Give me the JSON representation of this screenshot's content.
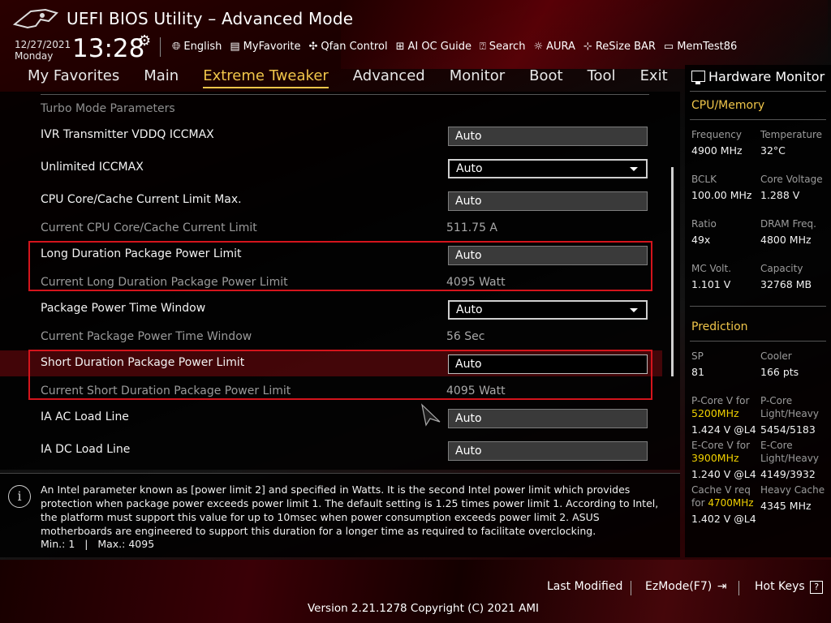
{
  "app": {
    "title": "UEFI BIOS Utility – Advanced Mode"
  },
  "datetime": {
    "date": "12/27/2021",
    "day": "Monday",
    "time": "13:28"
  },
  "toolbar": [
    {
      "label": "English",
      "icon": "globe-icon"
    },
    {
      "label": "MyFavorite",
      "icon": "favorite-icon"
    },
    {
      "label": "Qfan Control",
      "icon": "fan-icon"
    },
    {
      "label": "AI OC Guide",
      "icon": "ai-guide-icon"
    },
    {
      "label": "Search",
      "icon": "search-icon"
    },
    {
      "label": "AURA",
      "icon": "aura-icon"
    },
    {
      "label": "ReSize BAR",
      "icon": "resize-bar-icon"
    },
    {
      "label": "MemTest86",
      "icon": "memtest-icon"
    }
  ],
  "menu": [
    {
      "label": "My Favorites",
      "active": false
    },
    {
      "label": "Main",
      "active": false
    },
    {
      "label": "Extreme Tweaker",
      "active": true
    },
    {
      "label": "Advanced",
      "active": false
    },
    {
      "label": "Monitor",
      "active": false
    },
    {
      "label": "Boot",
      "active": false
    },
    {
      "label": "Tool",
      "active": false
    },
    {
      "label": "Exit",
      "active": false
    }
  ],
  "settings": {
    "section_title": "Turbo Mode Parameters",
    "rows": [
      {
        "label": "IVR Transmitter VDDQ ICCMAX",
        "value": "Auto",
        "kind": "field"
      },
      {
        "label": "Unlimited ICCMAX",
        "value": "Auto",
        "kind": "dropdown"
      },
      {
        "label": "CPU Core/Cache Current Limit Max.",
        "value": "Auto",
        "kind": "field"
      },
      {
        "label": "Current CPU Core/Cache Current Limit",
        "value": "511.75 A",
        "kind": "info"
      },
      {
        "label": "Long Duration Package Power Limit",
        "value": "Auto",
        "kind": "field"
      },
      {
        "label": "Current Long Duration Package Power Limit",
        "value": "4095 Watt",
        "kind": "info"
      },
      {
        "label": "Package Power Time Window",
        "value": "Auto",
        "kind": "dropdown"
      },
      {
        "label": "Current Package Power Time Window",
        "value": "56 Sec",
        "kind": "info"
      },
      {
        "label": "Short Duration Package Power Limit",
        "value": "Auto",
        "kind": "field-active"
      },
      {
        "label": "Current Short Duration Package Power Limit",
        "value": "4095 Watt",
        "kind": "info"
      },
      {
        "label": "IA AC Load Line",
        "value": "Auto",
        "kind": "field"
      },
      {
        "label": "IA DC Load Line",
        "value": "Auto",
        "kind": "field"
      }
    ]
  },
  "help": {
    "text": "An Intel parameter known as [power limit 2] and specified in Watts. It is the second Intel power limit which provides protection when package power exceeds power limit 1. The default setting is 1.25 times power limit 1. According to Intel, the platform must support this value for up to 10msec when power consumption exceeds power limit 2. ASUS motherboards are engineered to support this duration for a longer time as required to facilitate overclocking.",
    "minmax": "Min.: 1   |   Max.: 4095"
  },
  "hardware_monitor": {
    "title": "Hardware Monitor",
    "cpu_section": "CPU/Memory",
    "cpu": [
      {
        "label": "Frequency",
        "value": "4900 MHz"
      },
      {
        "label": "Temperature",
        "value": "32°C"
      },
      {
        "label": "BCLK",
        "value": "100.00 MHz"
      },
      {
        "label": "Core Voltage",
        "value": "1.288 V"
      },
      {
        "label": "Ratio",
        "value": "49x"
      },
      {
        "label": "DRAM Freq.",
        "value": "4800 MHz"
      },
      {
        "label": "MC Volt.",
        "value": "1.101 V"
      },
      {
        "label": "Capacity",
        "value": "32768 MB"
      }
    ],
    "prediction_section": "Prediction",
    "prediction": {
      "sp_label": "SP",
      "sp_value": "81",
      "cooler_label": "Cooler",
      "cooler_value": "166 pts",
      "pcore_label": "P-Core V for",
      "pcore_freq": "5200MHz",
      "pcore_value": "1.424 V @L4",
      "pcore_lh_label1": "P-Core",
      "pcore_lh_label2": "Light/Heavy",
      "pcore_lh_value": "5454/5183",
      "ecore_label": "E-Core V for",
      "ecore_freq": "3900MHz",
      "ecore_value": "1.240 V @L4",
      "ecore_lh_label1": "E-Core",
      "ecore_lh_label2": "Light/Heavy",
      "ecore_lh_value": "4149/3932",
      "cache_label1": "Cache V req",
      "cache_label2": "for",
      "cache_freq": "4700MHz",
      "cache_value": "1.402 V @L4",
      "heavy_cache_label": "Heavy Cache",
      "heavy_cache_value": "4345 MHz"
    }
  },
  "footer": {
    "last_modified": "Last Modified",
    "ezmode": "EzMode(F7)",
    "hotkeys": "Hot Keys",
    "version": "Version 2.21.1278 Copyright (C) 2021 AMI"
  },
  "colors": {
    "accent": "#f0c64a",
    "highlight_box": "#d4141c",
    "prediction_freq": "#f0d000"
  }
}
